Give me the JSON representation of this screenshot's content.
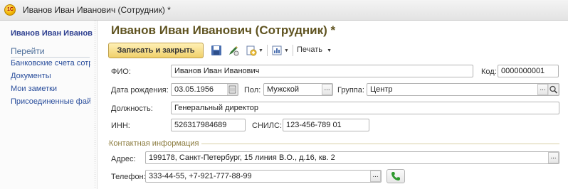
{
  "window": {
    "title": "Иванов Иван Иванович (Сотрудник) *",
    "logo_text": "1С"
  },
  "sidebar": {
    "header": "Иванов Иван Иванович (Сотрудник)",
    "section": "Перейти",
    "items": [
      {
        "label": "Банковские счета сотрудника"
      },
      {
        "label": "Документы"
      },
      {
        "label": "Мои заметки"
      },
      {
        "label": "Присоединенные файлы"
      }
    ]
  },
  "form": {
    "title": "Иванов Иван Иванович (Сотрудник) *",
    "toolbar": {
      "save_close": "Записать и закрыть",
      "print_label": "Печать"
    },
    "fio": {
      "label": "ФИО:",
      "value": "Иванов Иван Иванович"
    },
    "code": {
      "label": "Код:",
      "value": "0000000001"
    },
    "birth": {
      "label": "Дата рождения:",
      "value": "03.05.1956"
    },
    "gender": {
      "label": "Пол:",
      "value": "Мужской"
    },
    "group": {
      "label": "Группа:",
      "value": "Центр"
    },
    "position": {
      "label": "Должность:",
      "value": "Генеральный директор"
    },
    "inn": {
      "label": "ИНН:",
      "value": "526317984689"
    },
    "snils": {
      "label": "СНИЛС:",
      "value": "123-456-789 01"
    },
    "contact_group": "Контактная информация",
    "address": {
      "label": "Адрес:",
      "value": "199178, Санкт-Петербург, 15 линия В.О., д.16, кв. 2"
    },
    "phone": {
      "label": "Телефон:",
      "value": "333-44-55, +7-921-777-88-99"
    },
    "select_glyph": "...",
    "search_glyph": "🔍"
  },
  "colors": {
    "accent_title": "#5f5320",
    "button_gold": "#f0d06a",
    "link_blue": "#2a4e9c",
    "phone_green": "#2e9a2e"
  }
}
